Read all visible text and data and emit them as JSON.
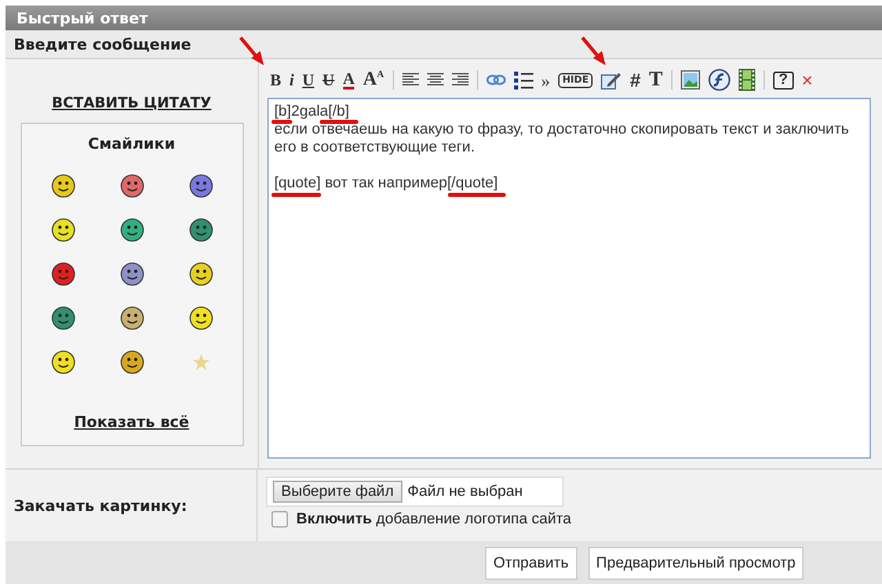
{
  "header": {
    "title": "Быстрый ответ"
  },
  "section_title": "Введите сообщение",
  "quote_link": "ВСТАВИТЬ ЦИТАТУ",
  "smileys": {
    "title": "Смайлики",
    "show_all": "Показать всё",
    "items": [
      {
        "kind": "face",
        "color": "#e8c81a"
      },
      {
        "kind": "face",
        "color": "#e06868"
      },
      {
        "kind": "face",
        "color": "#7878e0"
      },
      {
        "kind": "face",
        "color": "#e8e020"
      },
      {
        "kind": "face",
        "color": "#30b080"
      },
      {
        "kind": "face",
        "color": "#309070"
      },
      {
        "kind": "face",
        "color": "#e02020"
      },
      {
        "kind": "face",
        "color": "#9090c8"
      },
      {
        "kind": "face",
        "color": "#e8d020"
      },
      {
        "kind": "face",
        "color": "#309070"
      },
      {
        "kind": "face",
        "color": "#c8b070"
      },
      {
        "kind": "face",
        "color": "#f0e020"
      },
      {
        "kind": "face",
        "color": "#f0e020"
      },
      {
        "kind": "face",
        "color": "#d8a820"
      },
      {
        "kind": "star",
        "color": "#e8d890"
      }
    ]
  },
  "toolbar": [
    {
      "kind": "bold",
      "label": "B"
    },
    {
      "kind": "italic",
      "label": "i"
    },
    {
      "kind": "underline",
      "label": "U"
    },
    {
      "kind": "strike",
      "label": "U"
    },
    {
      "kind": "color",
      "label": "A"
    },
    {
      "kind": "size",
      "label": "A$^{A}$"
    },
    {
      "kind": "divider"
    },
    {
      "kind": "align-left"
    },
    {
      "kind": "align-center"
    },
    {
      "kind": "align-right"
    },
    {
      "kind": "divider"
    },
    {
      "kind": "link"
    },
    {
      "kind": "list"
    },
    {
      "kind": "quote",
      "label": "»"
    },
    {
      "kind": "hide",
      "label": "HIDE"
    },
    {
      "kind": "edit"
    },
    {
      "kind": "plain",
      "label": "#"
    },
    {
      "kind": "serif",
      "label": "T"
    },
    {
      "kind": "divider"
    },
    {
      "kind": "image"
    },
    {
      "kind": "flash"
    },
    {
      "kind": "film"
    },
    {
      "kind": "divider"
    },
    {
      "kind": "help",
      "label": "?"
    },
    {
      "kind": "close",
      "label": "×"
    }
  ],
  "message": {
    "value": "[b]2gala[/b]\nесли отвечаешь на какую то фразу, то достаточно скопировать текст и заключить его в соответствующие теги.\n\n[quote] вот так например[/quote]"
  },
  "upload": {
    "label": "Закачать картинку:",
    "choose_button": "Выберите файл",
    "file_status": "Файл не выбран",
    "logo_checkbox": {
      "checked": false,
      "label": "**Включить** добавление логотипа сайта"
    }
  },
  "buttons": [
    {
      "label": "Отправить"
    },
    {
      "label": "Предварительный просмотр"
    }
  ]
}
